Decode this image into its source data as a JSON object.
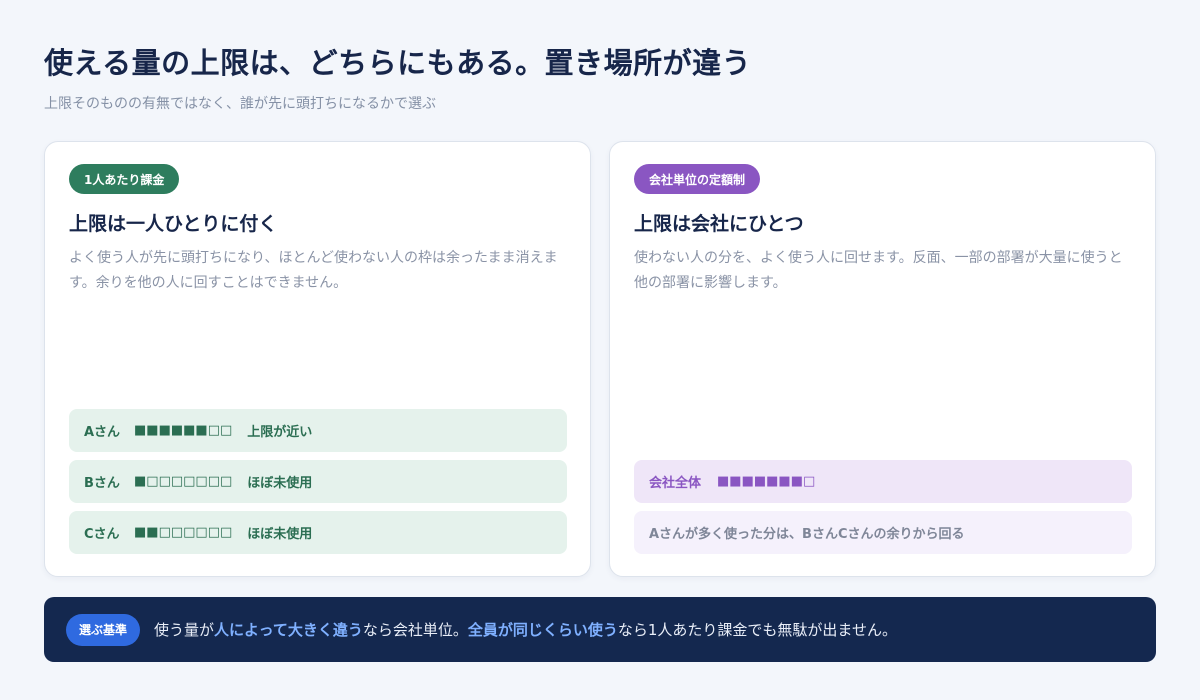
{
  "header": {
    "title": "使える量の上限は、どちらにもある。置き場所が違う",
    "subtitle": "上限そのものの有無ではなく、誰が先に頭打ちになるかで選ぶ"
  },
  "left_card": {
    "badge": "1人あたり課金",
    "title": "上限は一人ひとりに付く",
    "description": "よく使う人が先に頭打ちになり、ほとんど使わない人の枠は余ったまま消えます。余りを他の人に回すことはできません。",
    "rows": [
      {
        "who": "Aさん",
        "bar": "■■■■■■□□",
        "status": "上限が近い"
      },
      {
        "who": "Bさん",
        "bar": "■□□□□□□□",
        "status": "ほぼ未使用"
      },
      {
        "who": "Cさん",
        "bar": "■■□□□□□□",
        "status": "ほぼ未使用"
      }
    ]
  },
  "right_card": {
    "badge": "会社単位の定額制",
    "title": "上限は会社にひとつ",
    "description": "使わない人の分を、よく使う人に回せます。反面、一部の部署が大量に使うと他の部署に影響します。",
    "total_row": {
      "who": "会社全体",
      "bar": "■■■■■■■□"
    },
    "note": "Aさんが多く使った分は、BさんCさんの余りから回る"
  },
  "footer": {
    "badge": "選ぶ基準",
    "text_1": "使う量が",
    "highlight_1": "人によって大きく違う",
    "text_2": "なら会社単位。",
    "highlight_2": "全員が同じくらい使う",
    "text_3": "なら1人あたり課金でも無駄が出ません。"
  }
}
